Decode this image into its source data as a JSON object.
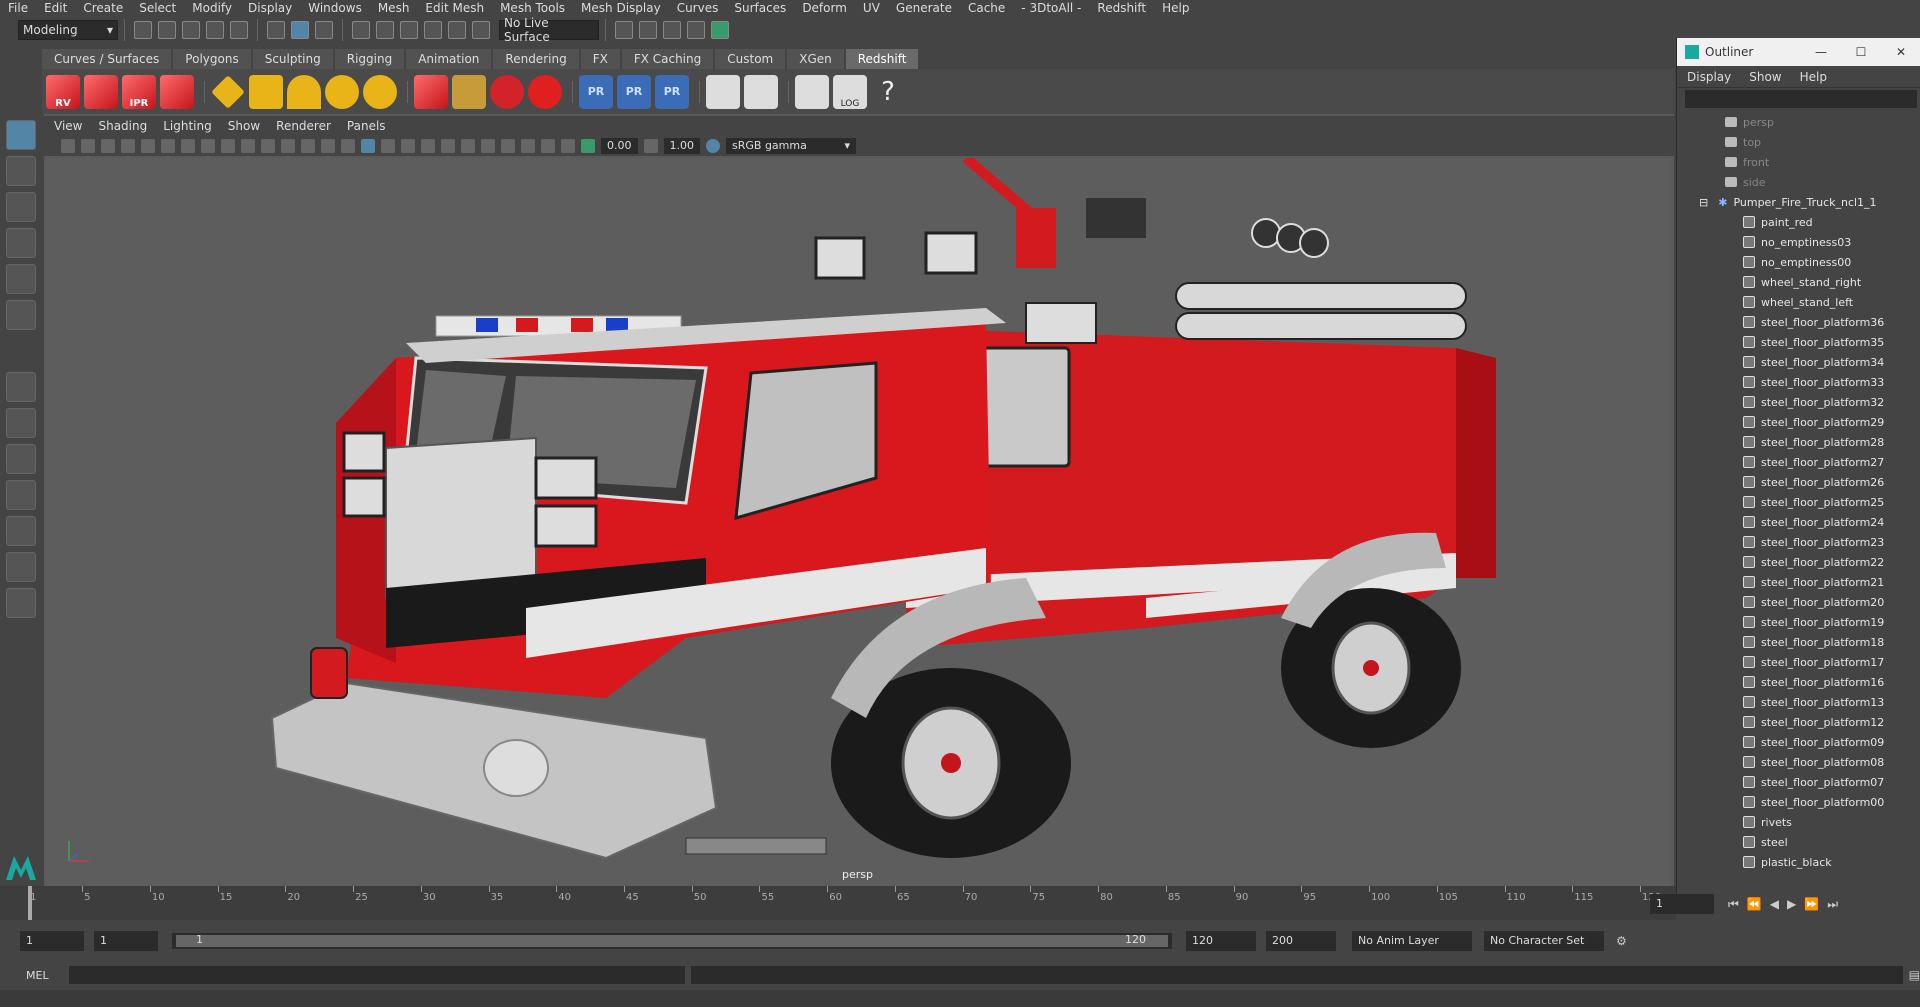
{
  "menubar": {
    "items": [
      "File",
      "Edit",
      "Create",
      "Select",
      "Modify",
      "Display",
      "Windows",
      "Mesh",
      "Edit Mesh",
      "Mesh Tools",
      "Mesh Display",
      "Curves",
      "Surfaces",
      "Deform",
      "UV",
      "Generate",
      "Cache",
      "- 3DtoAll -",
      "Redshift",
      "Help"
    ]
  },
  "toolbar": {
    "mode": "Modeling",
    "live_surface": "No Live Surface"
  },
  "shelf": {
    "tabs": [
      "Curves / Surfaces",
      "Polygons",
      "Sculpting",
      "Rigging",
      "Animation",
      "Rendering",
      "FX",
      "FX Caching",
      "Custom",
      "XGen",
      "Redshift"
    ],
    "active_tab": "Redshift",
    "icon_labels": [
      "RV",
      "IPR",
      "PR",
      "PR",
      "PR",
      "LOG",
      "?"
    ]
  },
  "viewport": {
    "menu": [
      "View",
      "Shading",
      "Lighting",
      "Show",
      "Renderer",
      "Panels"
    ],
    "exposure": "0.00",
    "gamma": "1.00",
    "color_space": "sRGB gamma",
    "camera": "persp"
  },
  "outliner": {
    "title": "Outliner",
    "menu": [
      "Display",
      "Show",
      "Help"
    ],
    "cameras": [
      "persp",
      "top",
      "front",
      "side"
    ],
    "group": "Pumper_Fire_Truck_ncl1_1",
    "children": [
      "paint_red",
      "no_emptiness03",
      "no_emptiness00",
      "wheel_stand_right",
      "wheel_stand_left",
      "steel_floor_platform36",
      "steel_floor_platform35",
      "steel_floor_platform34",
      "steel_floor_platform33",
      "steel_floor_platform32",
      "steel_floor_platform29",
      "steel_floor_platform28",
      "steel_floor_platform27",
      "steel_floor_platform26",
      "steel_floor_platform25",
      "steel_floor_platform24",
      "steel_floor_platform23",
      "steel_floor_platform22",
      "steel_floor_platform21",
      "steel_floor_platform20",
      "steel_floor_platform19",
      "steel_floor_platform18",
      "steel_floor_platform17",
      "steel_floor_platform16",
      "steel_floor_platform13",
      "steel_floor_platform12",
      "steel_floor_platform09",
      "steel_floor_platform08",
      "steel_floor_platform07",
      "steel_floor_platform00",
      "rivets",
      "steel",
      "plastic_black"
    ]
  },
  "timeline": {
    "ticks": [
      "1",
      "5",
      "10",
      "15",
      "20",
      "25",
      "30",
      "35",
      "40",
      "45",
      "50",
      "55",
      "60",
      "65",
      "70",
      "75",
      "80",
      "85",
      "90",
      "95",
      "100",
      "105",
      "110",
      "115",
      "120"
    ],
    "current_frame": "1"
  },
  "range": {
    "start": "1",
    "playback_start": "1",
    "slider_start": "1",
    "slider_end": "120",
    "playback_end": "120",
    "end": "200",
    "anim_layer": "No Anim Layer",
    "char_set": "No Character Set"
  },
  "cmd": {
    "label": "MEL"
  },
  "colors": {
    "accent": "#5285a6",
    "truck_red": "#d21a1f"
  }
}
